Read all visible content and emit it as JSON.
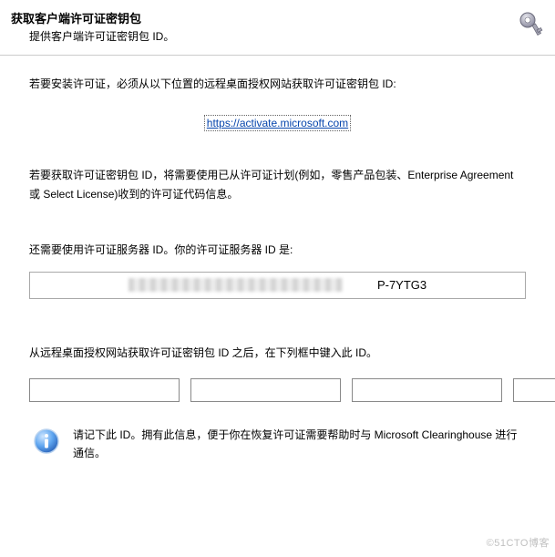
{
  "header": {
    "title": "获取客户端许可证密钥包",
    "subtitle": "提供客户端许可证密钥包 ID。"
  },
  "content": {
    "install_line": "若要安装许可证，必须从以下位置的远程桌面授权网站获取许可证密钥包 ID:",
    "activation_url": "https://activate.microsoft.com",
    "obtain_line": "若要获取许可证密钥包 ID，将需要使用已从许可证计划(例如，零售产品包装、Enterprise Agreement 或 Select License)收到的许可证代码信息。",
    "server_id_label": "还需要使用许可证服务器 ID。你的许可证服务器 ID 是:",
    "server_id_visible_suffix": "P-7YTG3",
    "enter_line": "从远程桌面授权网站获取许可证密钥包 ID 之后，在下列框中键入此 ID。",
    "keypack_inputs": [
      "",
      "",
      "",
      "",
      "",
      "",
      ""
    ],
    "note_text": "请记下此 ID。拥有此信息，便于你在恢复许可证需要帮助时与 Microsoft Clearinghouse 进行通信。"
  },
  "watermark": "©51CTO博客"
}
